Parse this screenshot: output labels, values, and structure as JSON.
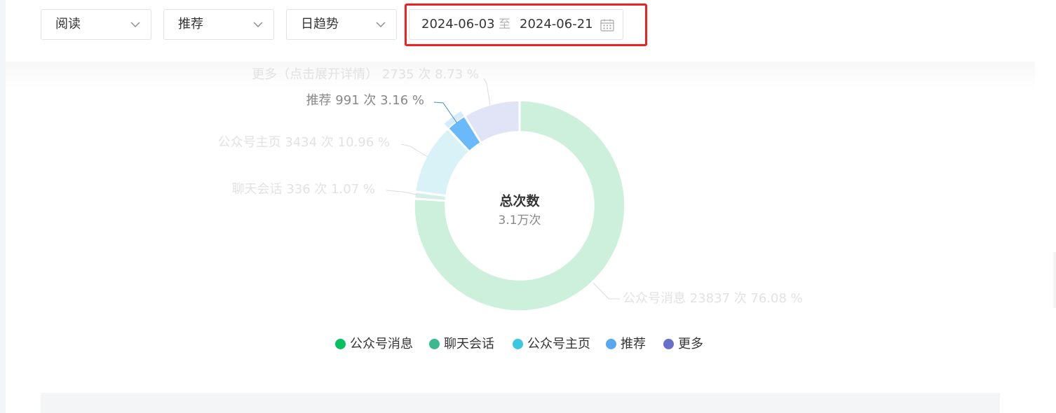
{
  "filters": {
    "metric": "阅读",
    "source": "推荐",
    "trend": "日趋势"
  },
  "date_range": {
    "start": "2024-06-03",
    "separator": "至",
    "end": "2024-06-21"
  },
  "chart_data": {
    "type": "pie",
    "center_title": "总次数",
    "center_value": "3.1万次",
    "slices": [
      {
        "name": "公众号消息",
        "label": "公众号消息 23837 次 76.08 %",
        "value": 23837,
        "percent": 76.08,
        "color": "#cdf0dc",
        "legend_color": "#07c160",
        "highlighted": false
      },
      {
        "name": "聊天会话",
        "label": "聊天会话 336 次 1.07 %",
        "value": 336,
        "percent": 1.07,
        "color": "#d3efe7",
        "legend_color": "#3bb98e",
        "highlighted": false
      },
      {
        "name": "公众号主页",
        "label": "公众号主页 3434 次 10.96 %",
        "value": 3434,
        "percent": 10.96,
        "color": "#d8f2f8",
        "legend_color": "#3cc7e0",
        "highlighted": false
      },
      {
        "name": "推荐",
        "label": "推荐 991 次 3.16 %",
        "value": 991,
        "percent": 3.16,
        "color": "#69b9fb",
        "legend_color": "#58a8f0",
        "highlighted": true
      },
      {
        "name": "更多",
        "label": "更多（点击展开详情） 2735 次 8.73 %",
        "value": 2735,
        "percent": 8.73,
        "color": "#e1e3f6",
        "legend_color": "#6670c9",
        "highlighted": false
      }
    ],
    "legend": [
      "公众号消息",
      "聊天会话",
      "公众号主页",
      "推荐",
      "更多"
    ]
  },
  "colors": {
    "highlight_border": "#ee2222",
    "label_faded": "#e2e2e2",
    "label_active": "#888888",
    "leader_active": "#3a8fd6"
  }
}
